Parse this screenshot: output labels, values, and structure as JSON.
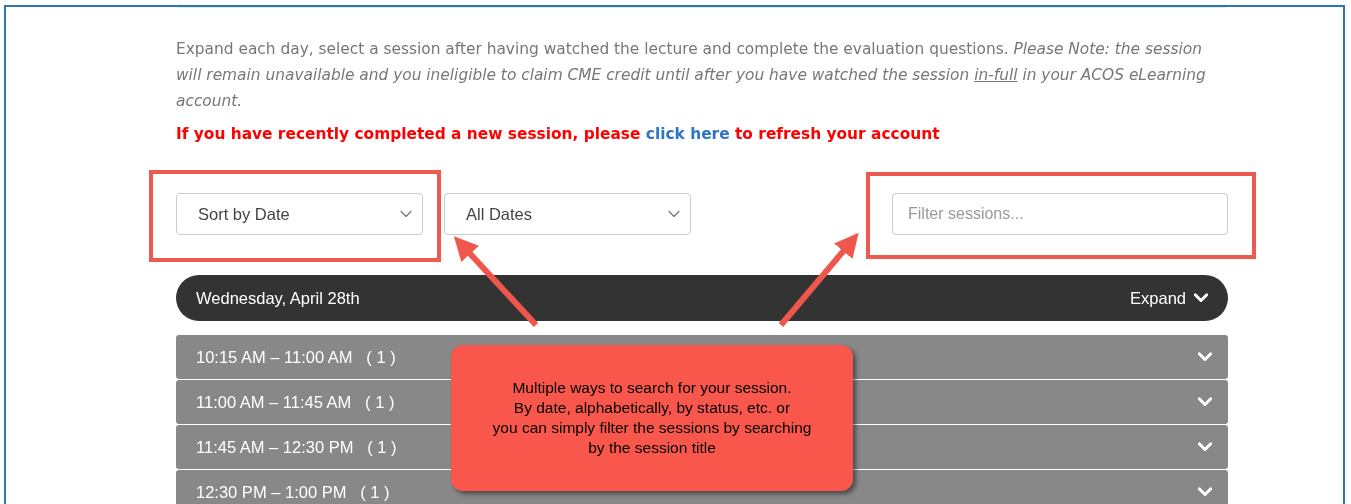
{
  "instructions": {
    "text": "Expand each day, select a session after having watched the lecture and complete the evaluation questions.",
    "note_before": "Please Note: the session will remain unavailable and you ineligible to claim CME credit until after you have watched the session",
    "note_underlined": "in-full",
    "note_after": "in your ACOS eLearning account."
  },
  "refresh": {
    "before": "If you have recently completed a new session, please",
    "link": "click here",
    "after": "to refresh your account"
  },
  "filters": {
    "sort": "Sort by Date",
    "dates": "All Dates",
    "search": {
      "placeholder": "Filter sessions..."
    }
  },
  "day": {
    "title": "Wednesday, April 28th",
    "toggle": "Expand",
    "expanded": false
  },
  "sessions": [
    {
      "time": "10:15 AM – 11:00 AM",
      "count": "( 1 )"
    },
    {
      "time": "11:00 AM – 11:45 AM",
      "count": "( 1 )"
    },
    {
      "time": "11:45 AM – 12:30 PM",
      "count": "( 1 )"
    },
    {
      "time": "12:30 PM – 1:00 PM",
      "count": "( 1 )"
    }
  ],
  "callout": {
    "lines": [
      "Multiple ways to search for your session.",
      "By date, alphabetically, by status, etc. or",
      "you can simply filter the sessions by searching",
      "by the session title"
    ]
  }
}
